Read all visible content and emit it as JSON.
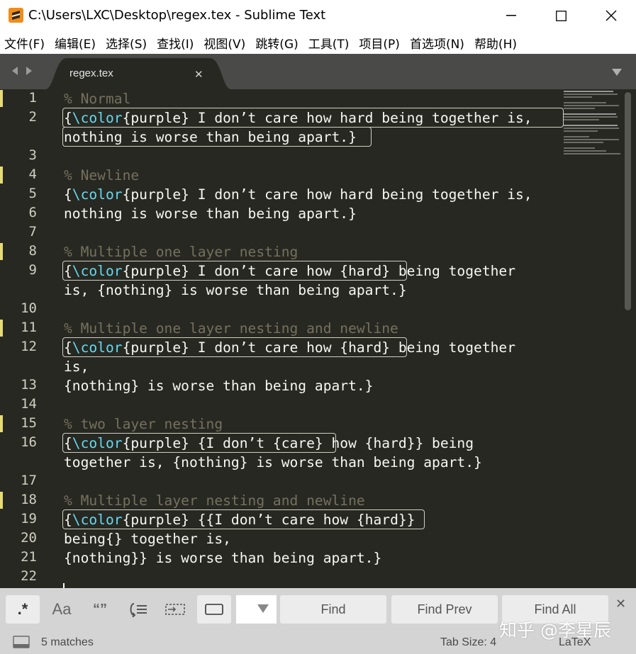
{
  "window": {
    "title": "C:\\Users\\LXC\\Desktop\\regex.tex - Sublime Text"
  },
  "menu": [
    "文件(F)",
    "编辑(E)",
    "选择(S)",
    "查找(I)",
    "视图(V)",
    "跳转(G)",
    "工具(T)",
    "项目(P)",
    "首选项(N)",
    "帮助(H)"
  ],
  "tab": {
    "label": "regex.tex",
    "close": "✕"
  },
  "code_lines": [
    {
      "n": "1",
      "text": "% Normal"
    },
    {
      "n": "2",
      "text": "{\\color{purple} I don’t care how hard being together is,"
    },
    {
      "n": "",
      "text": "nothing is worse than being apart.}"
    },
    {
      "n": "3",
      "text": ""
    },
    {
      "n": "4",
      "text": "% Newline"
    },
    {
      "n": "5",
      "text": "{\\color{purple} I don’t care how hard being together is,"
    },
    {
      "n": "6",
      "text": "nothing is worse than being apart.}"
    },
    {
      "n": "7",
      "text": ""
    },
    {
      "n": "8",
      "text": "% Multiple one layer nesting"
    },
    {
      "n": "9",
      "text": "{\\color{purple} I don’t care how {hard} being together"
    },
    {
      "n": "",
      "text": "is, {nothing} is worse than being apart.}"
    },
    {
      "n": "10",
      "text": ""
    },
    {
      "n": "11",
      "text": "% Multiple one layer nesting and newline"
    },
    {
      "n": "12",
      "text": "{\\color{purple} I don’t care how {hard} being together"
    },
    {
      "n": "",
      "text": "is,"
    },
    {
      "n": "13",
      "text": "{nothing} is worse than being apart.}"
    },
    {
      "n": "14",
      "text": ""
    },
    {
      "n": "15",
      "text": "% two layer nesting"
    },
    {
      "n": "16",
      "text": "{\\color{purple} {I don’t {care} how {hard}} being"
    },
    {
      "n": "",
      "text": "together is, {nothing} is worse than being apart.}"
    },
    {
      "n": "17",
      "text": ""
    },
    {
      "n": "18",
      "text": "% Multiple layer nesting and newline"
    },
    {
      "n": "19",
      "text": "{\\color{purple} {{I don’t care how {hard}}"
    },
    {
      "n": "20",
      "text": "being{} together is,"
    },
    {
      "n": "21",
      "text": "{nothing}} is worse than being apart.}"
    },
    {
      "n": "22",
      "text": ""
    }
  ],
  "find": {
    "regex_label": ".*",
    "case_label": "Aa",
    "word_label": "“”",
    "find_label": "Find",
    "find_prev_label": "Find Prev",
    "find_all_label": "Find All",
    "close": "✕"
  },
  "status": {
    "matches": "5 matches",
    "tab_size": "Tab Size: 4",
    "syntax": "LaTeX"
  },
  "watermark": "知乎 @李星辰",
  "colors": {
    "editor_bg": "#272822",
    "comment": "#75715e",
    "keyword": "#66d9ef",
    "text": "#f8f8f2",
    "marker": "#e6db74"
  }
}
